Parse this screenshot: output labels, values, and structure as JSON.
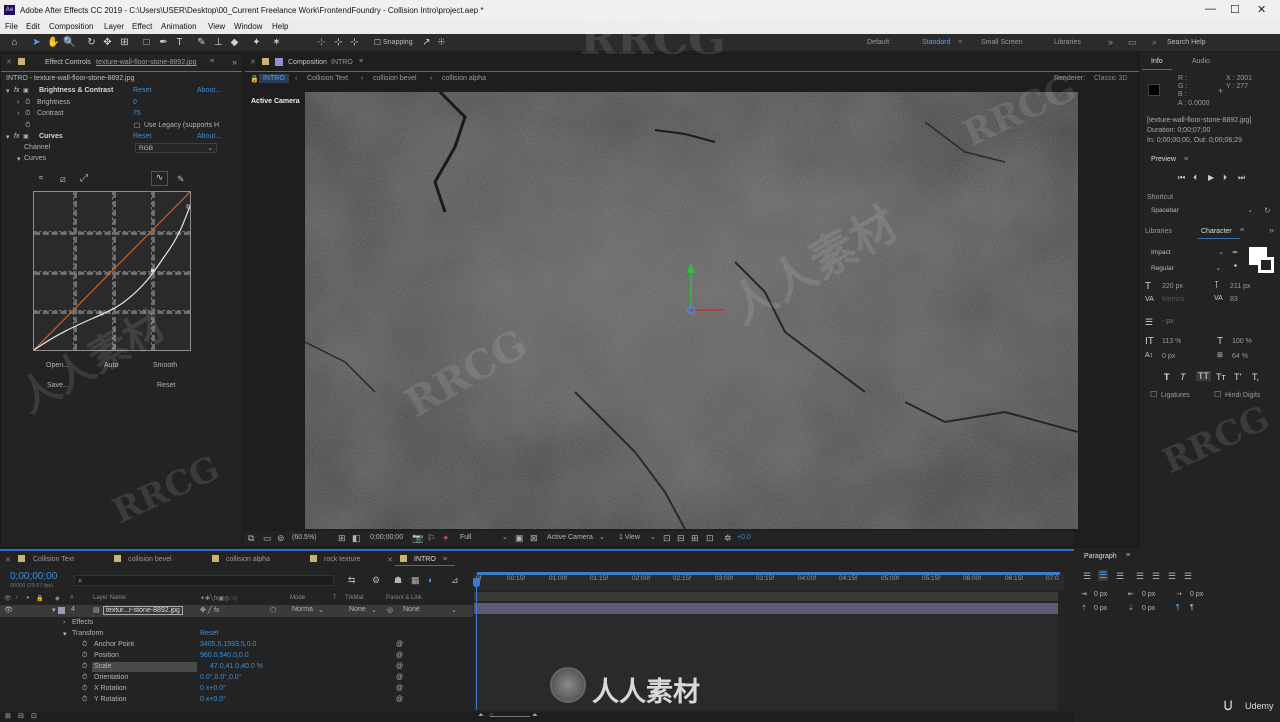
{
  "app": {
    "title": "Adobe After Effects CC 2019 - C:\\Users\\USER\\Desktop\\00_Current Freelance Work\\FrontendFoundry - Collision Intro\\project.aep *",
    "logo": "Ae"
  },
  "menu": [
    "File",
    "Edit",
    "Composition",
    "Layer",
    "Effect",
    "Animation",
    "View",
    "Window",
    "Help"
  ],
  "toolbar": {
    "snapping": "Snapping",
    "workspaces": [
      "Default",
      "Standard",
      "Small Screen",
      "Libraries"
    ],
    "search_placeholder": "Search Help"
  },
  "effect_controls": {
    "tab_label": "Effect Controls",
    "tab_layer": "texture-wall-floor-stone-8892.jpg",
    "header": "INTRO - texture-wall-floor-stone-8892.jpg",
    "bc": {
      "name": "Brightness & Contrast",
      "reset": "Reset",
      "about": "About...",
      "brightness_label": "Brightness",
      "brightness": "0",
      "contrast_label": "Contrast",
      "contrast": "75",
      "legacy": "Use Legacy (supports H"
    },
    "curves": {
      "name": "Curves",
      "reset": "Reset",
      "about": "About...",
      "channel_label": "Channel",
      "channel": "RGB",
      "curves_label": "Curves",
      "open": "Open...",
      "auto": "Auto",
      "smooth": "Smooth",
      "save": "Save...",
      "reset2": "Reset"
    }
  },
  "comp": {
    "tab": "Composition",
    "name": "INTRO",
    "breadcrumbs": [
      "INTRO",
      "Collision Text",
      "collision bevel",
      "collision alpha"
    ],
    "renderer_label": "Renderer:",
    "renderer": "Classic 3D",
    "camera_label": "Active Camera"
  },
  "viewer_bar": {
    "zoom": "(60.5%)",
    "time": "0;00;00;00",
    "quality": "Full",
    "camera": "Active Camera",
    "views": "1 View",
    "exposure": "+0.0"
  },
  "timeline": {
    "tabs": [
      "Collision Text",
      "collision bevel",
      "collision alpha",
      "rock texture",
      "INTRO"
    ],
    "timecode": "0;00;00;00",
    "fps": "00000 (29.97 fps)",
    "col_layer": "Layer Name",
    "col_mode": "Mode",
    "col_t": "T",
    "col_trkmat": "TrkMat",
    "col_parent": "Parent & Link",
    "layer": {
      "num": "4",
      "name": "textur...r-stone-8892.jpg",
      "mode": "Norma",
      "trkmat": "None",
      "parent": "None"
    },
    "props": [
      {
        "label": "Effects",
        "value": ""
      },
      {
        "label": "Transform",
        "value": "Reset"
      },
      {
        "label": "Anchor Point",
        "value": "3405.5,1593.5,0.0"
      },
      {
        "label": "Position",
        "value": "960.0,540.0,0.0"
      },
      {
        "label": "Scale",
        "value": "47.0,41.0,40.0 %"
      },
      {
        "label": "Orientation",
        "value": "0.0°,0.0°,0.0°"
      },
      {
        "label": "X Rotation",
        "value": "0 x+0.0°"
      },
      {
        "label": "Y Rotation",
        "value": "0 x+0.0°"
      }
    ],
    "ruler": [
      "0f",
      "00:15f",
      "01:00f",
      "01:15f",
      "02:00f",
      "02:15f",
      "03:00f",
      "03:15f",
      "04:00f",
      "04:15f",
      "05:00f",
      "05:15f",
      "06:00f",
      "06:15f",
      "07:0"
    ]
  },
  "info": {
    "tab": "Info",
    "audio": "Audio",
    "r": "R :",
    "g": "G :",
    "b": "B :",
    "a": "A : 0.0000",
    "x": "X : 2001",
    "y": "Y : 277",
    "file": "[texture-wall-floor-stone-8892.jpg]",
    "duration": "Duration: 0;00;07;00",
    "inout": "In: 0;00;00;00, Out: 0;00;06;29"
  },
  "preview": {
    "title": "Preview",
    "shortcut_label": "Shortcut",
    "shortcut": "Spacebar"
  },
  "character": {
    "libraries": "Libraries",
    "tab": "Character",
    "font": "Impact",
    "style": "Regular",
    "size": "220 px",
    "leading": "211 px",
    "kerning": "Metrics",
    "tracking": "83",
    "indent": "- px",
    "vscale": "113 %",
    "hscale": "100 %",
    "baseline": "0 px",
    "tsume": "64 %",
    "ligatures": "Ligatures",
    "hindi": "Hindi Digits",
    "styles": [
      "T",
      "T",
      "TT",
      "Tт",
      "T'",
      "T,"
    ]
  },
  "paragraph": {
    "title": "Paragraph",
    "vals": [
      "0 px",
      "0 px",
      "0 px",
      "0 px",
      "0 px"
    ]
  },
  "watermark": {
    "brand": "RRCG",
    "cn": "人人素材",
    "udemy": "Udemy"
  }
}
